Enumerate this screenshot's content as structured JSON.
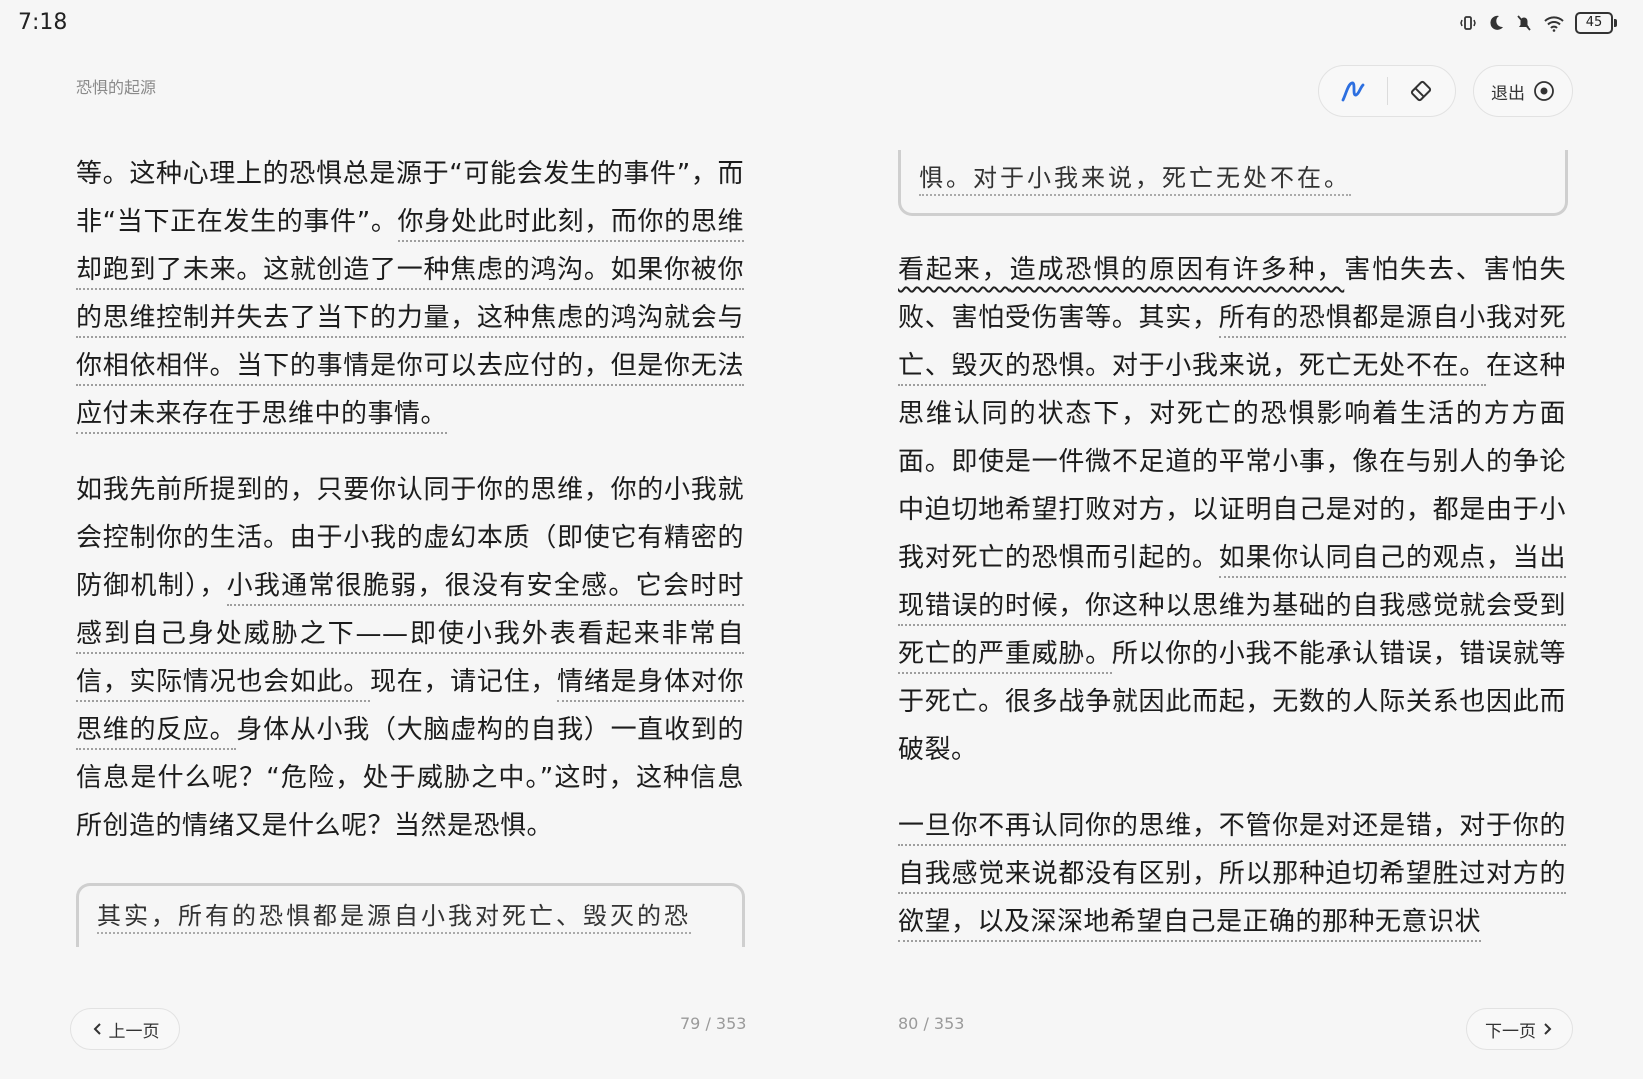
{
  "status": {
    "time": "7:18",
    "battery": "45"
  },
  "book_title": "恐惧的起源",
  "toolbar": {
    "exit_label": "退出"
  },
  "left_page": {
    "paragraphs": [
      {
        "segments": [
          {
            "text": "等。这种心理上的恐惧总是源于“可能会发生的事件”，而非“当下正在发生的事件”。",
            "style": "plain"
          },
          {
            "text": "你身处此时此刻，而你的思维却跑到了未来。这就创造了一种焦虑的鸿沟。如果你被你的思维控制并失去了当下的力量，这种焦虑的鸿沟就会与你相依相伴。当下的事情是你可以去应付的，但是你无法应付未来存在于思维中的事情。",
            "style": "dotted"
          }
        ]
      },
      {
        "segments": [
          {
            "text": "如我先前所提到的，只要你认同于你的思维，你的小我就会控制你的生活。由于小我的虚幻本质（即使它有精密的防御机制），",
            "style": "plain"
          },
          {
            "text": "小我通常很脆弱，很没有安全感。它会时时感到自己身处威胁之下——即使小我外表看起来非常自信，实际情况也会如此。",
            "style": "dotted"
          },
          {
            "text": "现在，请记住，",
            "style": "plain"
          },
          {
            "text": "情绪是身体对你思维的反应。",
            "style": "dotted"
          },
          {
            "text": "身体从小我（大脑虚构的自我）一直收到的信息是什么呢？“危险，处于威胁之中。”这时，这种信息所创造的情绪又是什么呢？当然是恐惧。",
            "style": "plain"
          }
        ]
      }
    ],
    "note": "其实，所有的恐惧都是源自小我对死亡、毁灭的恐",
    "page_number": "79 / 353",
    "prev_label": "上一页"
  },
  "right_page": {
    "note": "惧。对于小我来说，死亡无处不在。",
    "paragraphs": [
      {
        "segments": [
          {
            "text": "看起来，",
            "style": "wavy"
          },
          {
            "text": "造成恐惧的原因有许多种，",
            "style": "wavy"
          },
          {
            "text": "害怕失去、害怕失败、害怕受伤害等。其实，",
            "style": "plain"
          },
          {
            "text": "所有的恐惧都是源自小我对死亡、毁灭的恐惧。对于小我来说，死亡无处不在。",
            "style": "dotted"
          },
          {
            "text": "在这种思维认同的状态下，对死亡的恐惧影响着生活的方方面面。即使是一件微不足道的平常小事，像在与别人的争论中迫切地希望打败对方，以证明自己是对的，都是由于小我对死亡的恐惧而引起的。",
            "style": "plain"
          },
          {
            "text": "如果你认同自己的观点，当出现错误的时候，你这种以思维为基础的自我感觉就会受到死亡的严重威胁。",
            "style": "dotted"
          },
          {
            "text": "所以你的小我不能承认错误，错误就等于死亡。很多战争就因此而起，无数的人际关系也因此而破裂。",
            "style": "plain"
          }
        ]
      },
      {
        "segments": [
          {
            "text": "一旦你不再认同你的思维，不管你是对还是错，对于你的自我感觉来说都没有区别，所以那种迫切希望胜过对方的欲望，以及深深地希望自己是正确的那种无意识状",
            "style": "dotted"
          }
        ]
      }
    ],
    "page_number": "80 / 353",
    "next_label": "下一页"
  }
}
